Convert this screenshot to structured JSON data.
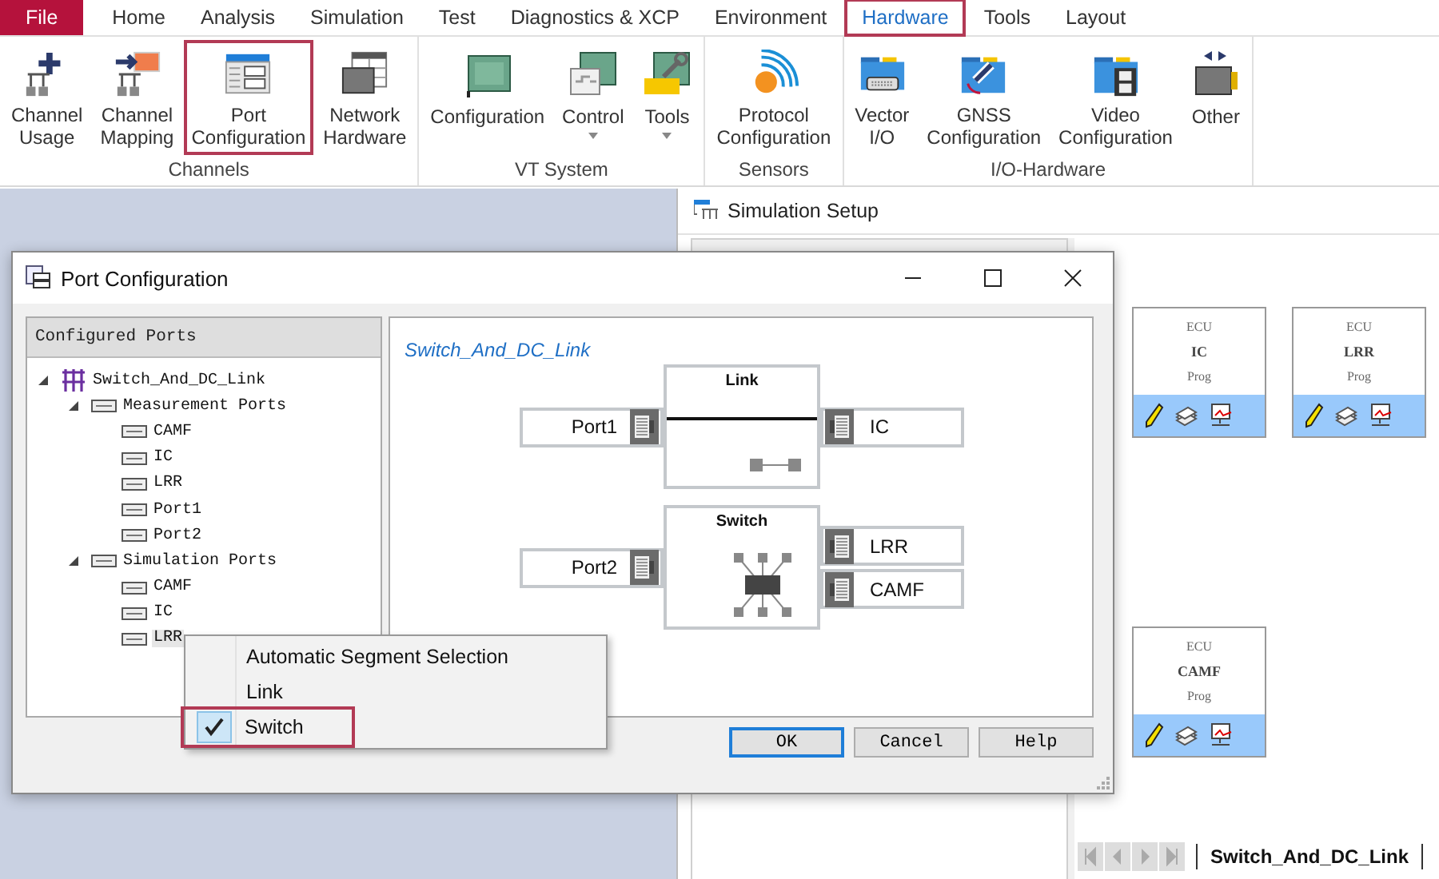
{
  "menu_tabs": [
    {
      "label": "File",
      "kind": "file",
      "selected": false,
      "annotated": false
    },
    {
      "label": "Home",
      "kind": "tab",
      "selected": false,
      "annotated": false
    },
    {
      "label": "Analysis",
      "kind": "tab",
      "selected": false,
      "annotated": false
    },
    {
      "label": "Simulation",
      "kind": "tab",
      "selected": false,
      "annotated": false
    },
    {
      "label": "Test",
      "kind": "tab",
      "selected": false,
      "annotated": false
    },
    {
      "label": "Diagnostics & XCP",
      "kind": "tab",
      "selected": false,
      "annotated": false
    },
    {
      "label": "Environment",
      "kind": "tab",
      "selected": false,
      "annotated": false
    },
    {
      "label": "Hardware",
      "kind": "tab",
      "selected": true,
      "annotated": true
    },
    {
      "label": "Tools",
      "kind": "tab",
      "selected": false,
      "annotated": false
    },
    {
      "label": "Layout",
      "kind": "tab",
      "selected": false,
      "annotated": false
    }
  ],
  "ribbon_groups": [
    {
      "label": "Channels",
      "buttons": [
        {
          "label": "Channel\nUsage",
          "kind": "channel-usage",
          "dropdown": false,
          "annotated": false
        },
        {
          "label": "Channel\nMapping",
          "kind": "channel-mapping",
          "dropdown": false,
          "annotated": false
        },
        {
          "label": "Port\nConfiguration",
          "kind": "port-config",
          "dropdown": false,
          "annotated": true
        },
        {
          "label": "Network\nHardware",
          "kind": "network-hardware",
          "dropdown": false,
          "annotated": false
        }
      ]
    },
    {
      "label": "VT System",
      "buttons": [
        {
          "label": "Configuration",
          "kind": "vt-config",
          "dropdown": false,
          "annotated": false
        },
        {
          "label": "Control",
          "kind": "vt-control",
          "dropdown": true,
          "annotated": false
        },
        {
          "label": "Tools",
          "kind": "vt-tools",
          "dropdown": true,
          "annotated": false
        }
      ]
    },
    {
      "label": "Sensors",
      "buttons": [
        {
          "label": "Protocol\nConfiguration",
          "kind": "protocol",
          "dropdown": false,
          "annotated": false
        }
      ]
    },
    {
      "label": "I/O-Hardware",
      "buttons": [
        {
          "label": "Vector\nI/O",
          "kind": "vector-io",
          "dropdown": false,
          "annotated": false
        },
        {
          "label": "GNSS\nConfiguration",
          "kind": "gnss",
          "dropdown": false,
          "annotated": false
        },
        {
          "label": "Video\nConfiguration",
          "kind": "video",
          "dropdown": false,
          "annotated": false
        },
        {
          "label": "Other",
          "kind": "other",
          "dropdown": false,
          "annotated": false
        }
      ]
    }
  ],
  "simulation_setup": {
    "title": "Simulation Setup",
    "ecus": [
      {
        "type": "ECU",
        "name": "IC",
        "mode": "Prog"
      },
      {
        "type": "ECU",
        "name": "LRR",
        "mode": "Prog"
      },
      {
        "type": "ECU",
        "name": "CAMF",
        "mode": "Prog"
      }
    ],
    "sheet_tab": "Switch_And_DC_Link"
  },
  "dialog": {
    "title": "Port Configuration",
    "tree_header": "Configured Ports",
    "tree": [
      {
        "label": "Switch_And_DC_Link",
        "kind": "network",
        "expanded": true,
        "selected": false,
        "children": [
          {
            "label": "Measurement Ports",
            "kind": "group",
            "expanded": true,
            "selected": false,
            "children": [
              {
                "label": "CAMF",
                "kind": "port",
                "selected": false
              },
              {
                "label": "IC",
                "kind": "port",
                "selected": false
              },
              {
                "label": "LRR",
                "kind": "port",
                "selected": false
              },
              {
                "label": "Port1",
                "kind": "port",
                "selected": false
              },
              {
                "label": "Port2",
                "kind": "port",
                "selected": false
              }
            ]
          },
          {
            "label": "Simulation Ports",
            "kind": "group",
            "expanded": true,
            "selected": false,
            "children": [
              {
                "label": "CAMF",
                "kind": "port",
                "selected": false
              },
              {
                "label": "IC",
                "kind": "port",
                "selected": false
              },
              {
                "label": "LRR",
                "kind": "port",
                "selected": true
              }
            ]
          }
        ]
      }
    ],
    "diagram": {
      "title": "Switch_And_DC_Link",
      "segments": [
        {
          "kind": "link",
          "label": "Link",
          "left_ports": [
            "Port1"
          ],
          "right_ports": [
            "IC"
          ]
        },
        {
          "kind": "switch",
          "label": "Switch",
          "left_ports": [
            "Port2"
          ],
          "right_ports": [
            "LRR",
            "CAMF"
          ]
        }
      ]
    },
    "buttons": [
      {
        "label": "OK",
        "focused": true
      },
      {
        "label": "Cancel",
        "focused": false
      },
      {
        "label": "Help",
        "focused": false
      }
    ]
  },
  "context_menu": {
    "items": [
      {
        "label": "Automatic Segment Selection",
        "checked": false,
        "annotated": false
      },
      {
        "label": "Link",
        "checked": false,
        "annotated": false
      },
      {
        "label": "Switch",
        "checked": true,
        "annotated": true
      }
    ]
  }
}
